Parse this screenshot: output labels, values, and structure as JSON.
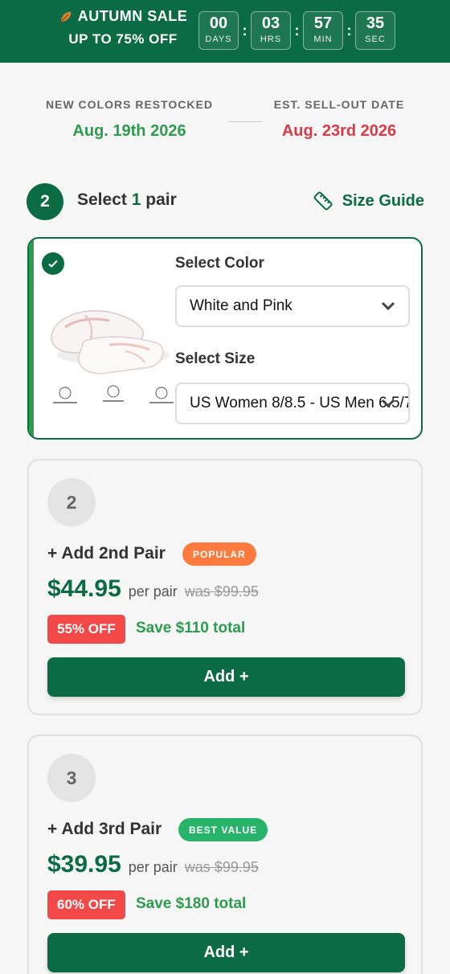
{
  "colors": {
    "brand": "#0b6b45",
    "green_text": "#2e9b4f",
    "red_text": "#d83a48",
    "badge_popular": "#ff7a3d",
    "badge_best": "#27b36a",
    "off_badge": "#f24848"
  },
  "banner": {
    "title": "AUTUMN SALE",
    "subtitle": "UP TO 75% OFF",
    "icon": "leaf-icon",
    "countdown": [
      {
        "value": "00",
        "label": "DAYS"
      },
      {
        "value": "03",
        "label": "HRS"
      },
      {
        "value": "57",
        "label": "MIN"
      },
      {
        "value": "35",
        "label": "SEC"
      }
    ],
    "separator": ":"
  },
  "restock": {
    "left_label": "NEW COLORS RESTOCKED",
    "left_date": "Aug. 19th 2026",
    "right_label": "EST. SELL-OUT DATE",
    "right_date": "Aug. 23rd 2026"
  },
  "step": {
    "number": "2",
    "text_before": "Select",
    "quantity": "1",
    "text_after": "pair",
    "size_guide": "Size Guide"
  },
  "selection": {
    "color_label": "Select Color",
    "color_value": "White and Pink",
    "size_label": "Select Size",
    "size_value": "US Women 8/8.5 - US Men 6.5/7"
  },
  "offers": [
    {
      "number": "2",
      "title": "+ Add 2nd Pair",
      "badge": "POPULAR",
      "price": "$44.95",
      "per": "per pair",
      "was": "was $99.95",
      "off": "55% OFF",
      "save": "Save $110 total",
      "button": "Add +"
    },
    {
      "number": "3",
      "title": "+ Add 3rd Pair",
      "badge": "BEST VALUE",
      "price": "$39.95",
      "per": "per pair",
      "was": "was $99.95",
      "off": "60% OFF",
      "save": "Save $180 total",
      "button": "Add +"
    }
  ]
}
